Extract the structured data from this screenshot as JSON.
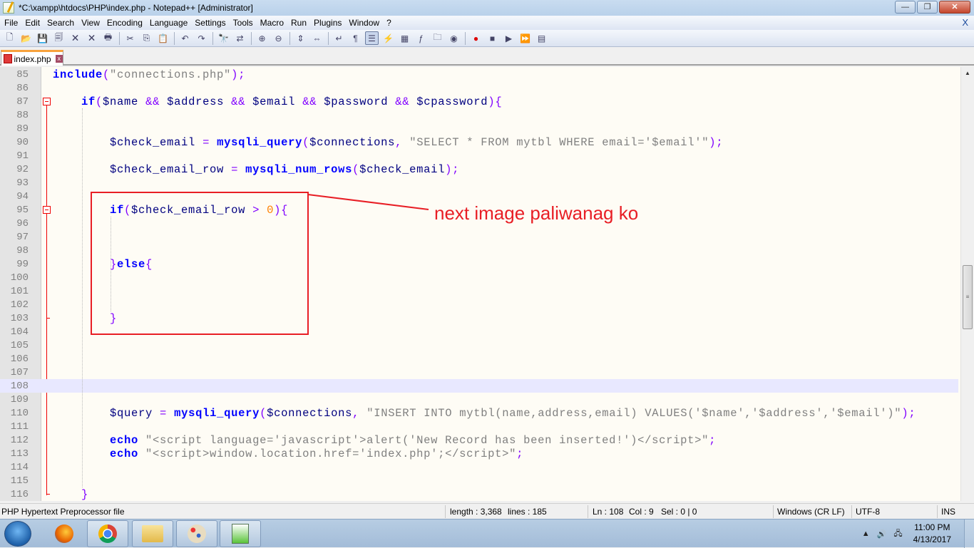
{
  "window": {
    "title": "*C:\\xampp\\htdocs\\PHP\\index.php - Notepad++ [Administrator]",
    "minimize": "—",
    "restore": "❐",
    "close": "✕"
  },
  "menu": {
    "items": [
      "File",
      "Edit",
      "Search",
      "View",
      "Encoding",
      "Language",
      "Settings",
      "Tools",
      "Macro",
      "Run",
      "Plugins",
      "Window",
      "?"
    ],
    "close_doc": "X"
  },
  "toolbar": {
    "groups": [
      [
        "new-file",
        "open-file",
        "save",
        "save-all",
        "close",
        "close-all",
        "print"
      ],
      [
        "cut",
        "copy",
        "paste"
      ],
      [
        "undo",
        "redo"
      ],
      [
        "find",
        "replace"
      ],
      [
        "zoom-in",
        "zoom-out"
      ],
      [
        "sync-vertical",
        "sync-horizontal"
      ],
      [
        "word-wrap",
        "show-all-chars",
        "indent-guide",
        "user-defined-language",
        "document-map",
        "function-list",
        "folder-as-workspace",
        "monitoring"
      ],
      [
        "record-macro",
        "stop-recording",
        "playback-macro",
        "run-macro-multiple",
        "save-macro"
      ]
    ],
    "active": "indent-guide"
  },
  "tabs": [
    {
      "label": "index.php",
      "close": "x",
      "modified": true
    }
  ],
  "editor": {
    "current_line": 108,
    "lines": [
      {
        "n": "85",
        "i": 0,
        "t": [
          [
            "k",
            "include"
          ],
          [
            "o",
            "("
          ],
          [
            "s",
            "\"connections.php\""
          ],
          [
            "o",
            ");"
          ]
        ]
      },
      {
        "n": "86",
        "i": 0,
        "t": []
      },
      {
        "n": "87",
        "i": 4,
        "t": [
          [
            "k",
            "if"
          ],
          [
            "o",
            "("
          ],
          [
            "v",
            "$name"
          ],
          [
            "",
            " "
          ],
          [
            "o",
            "&&"
          ],
          [
            "",
            " "
          ],
          [
            "v",
            "$address"
          ],
          [
            "",
            " "
          ],
          [
            "o",
            "&&"
          ],
          [
            "",
            " "
          ],
          [
            "v",
            "$email"
          ],
          [
            "",
            " "
          ],
          [
            "o",
            "&&"
          ],
          [
            "",
            " "
          ],
          [
            "v",
            "$password"
          ],
          [
            "",
            " "
          ],
          [
            "o",
            "&&"
          ],
          [
            "",
            " "
          ],
          [
            "v",
            "$cpassword"
          ],
          [
            "o",
            "){"
          ]
        ]
      },
      {
        "n": "88",
        "i": 0,
        "t": []
      },
      {
        "n": "89",
        "i": 0,
        "t": []
      },
      {
        "n": "90",
        "i": 8,
        "t": [
          [
            "v",
            "$check_email"
          ],
          [
            "",
            " "
          ],
          [
            "o",
            "="
          ],
          [
            "",
            " "
          ],
          [
            "k",
            "mysqli_query"
          ],
          [
            "o",
            "("
          ],
          [
            "v",
            "$connections"
          ],
          [
            "o",
            ","
          ],
          [
            "",
            " "
          ],
          [
            "s",
            "\"SELECT * FROM mytbl WHERE email='$email'\""
          ],
          [
            "o",
            ");"
          ]
        ]
      },
      {
        "n": "91",
        "i": 0,
        "t": []
      },
      {
        "n": "92",
        "i": 8,
        "t": [
          [
            "v",
            "$check_email_row"
          ],
          [
            "",
            " "
          ],
          [
            "o",
            "="
          ],
          [
            "",
            " "
          ],
          [
            "k",
            "mysqli_num_rows"
          ],
          [
            "o",
            "("
          ],
          [
            "v",
            "$check_email"
          ],
          [
            "o",
            ");"
          ]
        ]
      },
      {
        "n": "93",
        "i": 0,
        "t": []
      },
      {
        "n": "94",
        "i": 0,
        "t": []
      },
      {
        "n": "95",
        "i": 8,
        "t": [
          [
            "k",
            "if"
          ],
          [
            "o",
            "("
          ],
          [
            "v",
            "$check_email_row"
          ],
          [
            "",
            " "
          ],
          [
            "o",
            ">"
          ],
          [
            "",
            " "
          ],
          [
            "n",
            "0"
          ],
          [
            "o",
            "){"
          ]
        ]
      },
      {
        "n": "96",
        "i": 0,
        "t": []
      },
      {
        "n": "97",
        "i": 0,
        "t": []
      },
      {
        "n": "98",
        "i": 0,
        "t": []
      },
      {
        "n": "99",
        "i": 8,
        "t": [
          [
            "o",
            "}"
          ],
          [
            "k",
            "else"
          ],
          [
            "o",
            "{"
          ]
        ]
      },
      {
        "n": "100",
        "i": 0,
        "t": []
      },
      {
        "n": "101",
        "i": 0,
        "t": []
      },
      {
        "n": "102",
        "i": 0,
        "t": []
      },
      {
        "n": "103",
        "i": 8,
        "t": [
          [
            "o",
            "}"
          ]
        ]
      },
      {
        "n": "104",
        "i": 0,
        "t": []
      },
      {
        "n": "105",
        "i": 0,
        "t": []
      },
      {
        "n": "106",
        "i": 0,
        "t": []
      },
      {
        "n": "107",
        "i": 0,
        "t": []
      },
      {
        "n": "108",
        "i": 0,
        "t": []
      },
      {
        "n": "109",
        "i": 0,
        "t": []
      },
      {
        "n": "110",
        "i": 8,
        "t": [
          [
            "v",
            "$query"
          ],
          [
            "",
            " "
          ],
          [
            "o",
            "="
          ],
          [
            "",
            " "
          ],
          [
            "k",
            "mysqli_query"
          ],
          [
            "o",
            "("
          ],
          [
            "v",
            "$connections"
          ],
          [
            "o",
            ","
          ],
          [
            "",
            " "
          ],
          [
            "s",
            "\"INSERT INTO mytbl(name,address,email) VALUES('$name','$address','$email')\""
          ],
          [
            "o",
            ");"
          ]
        ]
      },
      {
        "n": "111",
        "i": 0,
        "t": []
      },
      {
        "n": "112",
        "i": 8,
        "t": [
          [
            "k",
            "echo"
          ],
          [
            "",
            " "
          ],
          [
            "s",
            "\"<script language='javascript'>alert('New Record has been inserted!')</script>\""
          ],
          [
            "o",
            ";"
          ]
        ]
      },
      {
        "n": "113",
        "i": 8,
        "t": [
          [
            "k",
            "echo"
          ],
          [
            "",
            " "
          ],
          [
            "s",
            "\"<script>window.location.href='index.php';</script>\""
          ],
          [
            "o",
            ";"
          ]
        ]
      },
      {
        "n": "114",
        "i": 0,
        "t": []
      },
      {
        "n": "115",
        "i": 0,
        "t": []
      },
      {
        "n": "116",
        "i": 4,
        "t": [
          [
            "o",
            "}"
          ]
        ]
      }
    ]
  },
  "annotation": {
    "text": "next image paliwanag ko",
    "color": "#e81e25"
  },
  "status": {
    "file_type": "PHP Hypertext Preprocessor file",
    "length": "length : 3,368",
    "lines": "lines : 185",
    "ln": "Ln : 108",
    "col": "Col : 9",
    "sel": "Sel : 0 | 0",
    "eol": "Windows (CR LF)",
    "encoding": "UTF-8",
    "mode": "INS"
  },
  "taskbar": {
    "apps": [
      "firefox",
      "chrome",
      "file-explorer",
      "paint",
      "notepad-plus-plus"
    ],
    "time": "11:00 PM",
    "date": "4/13/2017"
  }
}
